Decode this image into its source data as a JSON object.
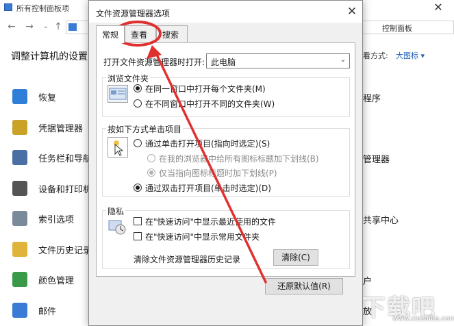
{
  "background_window": {
    "title": "所有控制面板项",
    "close_glyph": "✕",
    "address_right": "控制面板",
    "heading": "调整计算机的设置",
    "view_by_label": "看方式:",
    "view_by_value": "大图标 ▾",
    "items_left": [
      {
        "label": "恢复",
        "icon": "recovery-icon",
        "color": "#2f7fd8"
      },
      {
        "label": "凭据管理器",
        "icon": "credential-icon",
        "color": "#c9a227"
      },
      {
        "label": "任务栏和导航",
        "icon": "taskbar-icon",
        "color": "#4a6fa5"
      },
      {
        "label": "设备和打印机",
        "icon": "printer-icon",
        "color": "#555555"
      },
      {
        "label": "索引选项",
        "icon": "indexing-icon",
        "color": "#7a8a9a"
      },
      {
        "label": "文件历史记录",
        "icon": "file-history-icon",
        "color": "#e0b43a"
      },
      {
        "label": "颜色管理",
        "icon": "color-icon",
        "color": "#3a9a4a"
      },
      {
        "label": "邮件",
        "icon": "mail-icon",
        "color": "#3a7bd5"
      }
    ],
    "items_right": [
      "程序",
      "管理器",
      "共享中心",
      "户",
      "放"
    ]
  },
  "dialog": {
    "title": "文件资源管理器选项",
    "close_glyph": "✕",
    "tabs": [
      {
        "label": "常规"
      },
      {
        "label": "查看"
      },
      {
        "label": "搜索"
      }
    ],
    "open_in_label": "打开文件资源管理器时打开:",
    "open_in_value": "此电脑",
    "browse_group": {
      "title": "浏览文件夹",
      "options": [
        {
          "label": "在同一窗口中打开每个文件夹(M)",
          "checked": true
        },
        {
          "label": "在不同窗口中打开不同的文件夹(W)",
          "checked": false
        }
      ]
    },
    "click_group": {
      "title": "按如下方式单击项目",
      "options": [
        {
          "label": "通过单击打开项目(指向时选定)(S)",
          "checked": false,
          "disabled": false
        },
        {
          "label": "在我的浏览器中给所有图标标题加下划线(B)",
          "checked": false,
          "disabled": true
        },
        {
          "label": "仅当指向图标标题时加下划线(P)",
          "checked": true,
          "disabled": true
        },
        {
          "label": "通过双击打开项目(单击时选定)(D)",
          "checked": true,
          "disabled": false
        }
      ]
    },
    "privacy_group": {
      "title": "隐私",
      "checkboxes": [
        {
          "label": "在\"快速访问\"中显示最近使用的文件",
          "checked": false
        },
        {
          "label": "在\"快速访问\"中显示常用文件夹",
          "checked": false
        }
      ],
      "clear_label": "清除文件资源管理器历史记录",
      "clear_button": "清除(C)"
    },
    "restore_button": "还原默认值(R)"
  },
  "annotation": {
    "color": "#e03131"
  },
  "watermark": {
    "text": "下载吧",
    "url": "www.xiazaiba.com"
  }
}
